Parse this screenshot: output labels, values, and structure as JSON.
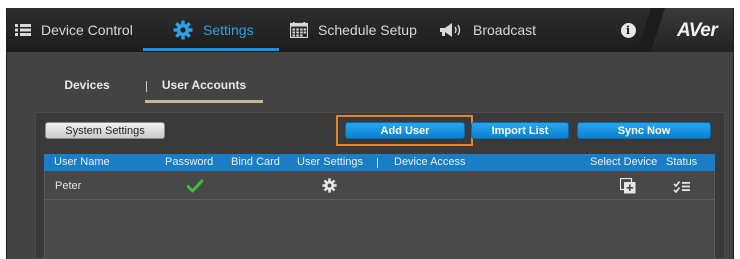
{
  "nav": {
    "items": [
      {
        "label": "Device Control",
        "icon": "list-icon"
      },
      {
        "label": "Settings",
        "icon": "gear-icon",
        "active": true
      },
      {
        "label": "Schedule Setup",
        "icon": "calendar-icon"
      },
      {
        "label": "Broadcast",
        "icon": "megaphone-icon"
      }
    ],
    "info_icon_text": "i",
    "brand": "AVer"
  },
  "subtabs": [
    {
      "label": "Devices"
    },
    {
      "label": "User Accounts",
      "active": true
    }
  ],
  "toolbar": {
    "system_settings": "System Settings",
    "add_user": "Add User",
    "import_list": "Import List",
    "sync_now": "Sync Now"
  },
  "table": {
    "columns": {
      "user_name": "User Name",
      "password": "Password",
      "bind_card": "Bind Card",
      "user_settings": "User Settings",
      "device_access": "Device Access",
      "select_device": "Select Device",
      "status": "Status"
    },
    "rows": [
      {
        "user_name": "Peter",
        "password_set": true,
        "settings_icon": "gear-icon",
        "select_device_icon": "add-device-icon",
        "status_icon": "sync-list-icon"
      }
    ]
  },
  "colors": {
    "accent": "#1f8fe0",
    "header_bg": "#1a7ec7",
    "button_blue": "#0b7fd0",
    "check_green": "#37c43a",
    "highlight_orange": "#e2822f",
    "tab_underline": "#c8b691"
  }
}
